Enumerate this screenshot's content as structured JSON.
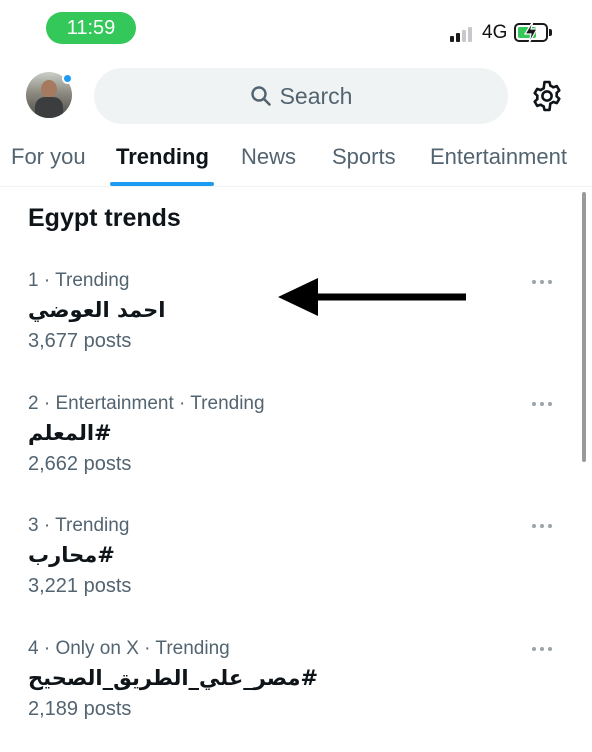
{
  "status_bar": {
    "time": "11:59",
    "network": "4G",
    "accent_color": "#34c759"
  },
  "header": {
    "avatar_icon": "user-avatar",
    "search_placeholder": "Search",
    "settings_icon": "gear-icon"
  },
  "tabs": [
    {
      "label": "For you",
      "active": false
    },
    {
      "label": "Trending",
      "active": true
    },
    {
      "label": "News",
      "active": false
    },
    {
      "label": "Sports",
      "active": false
    },
    {
      "label": "Entertainment",
      "active": false
    }
  ],
  "section_title": "Egypt trends",
  "trends": [
    {
      "meta": "1 · Trending",
      "name": "احمد العوضي",
      "posts": "3,677 posts"
    },
    {
      "meta": "2 · Entertainment · Trending",
      "name": "#المعلم",
      "posts": "2,662 posts"
    },
    {
      "meta": "3 · Trending",
      "name": "#محارب",
      "posts": "3,221 posts"
    },
    {
      "meta": "4 · Only on X · Trending",
      "name": "#مصر_علي_الطريق_الصحيح",
      "posts": "2,189 posts"
    }
  ],
  "colors": {
    "accent": "#1d9bf0",
    "secondary_text": "#536471",
    "primary_text": "#0f1419"
  }
}
